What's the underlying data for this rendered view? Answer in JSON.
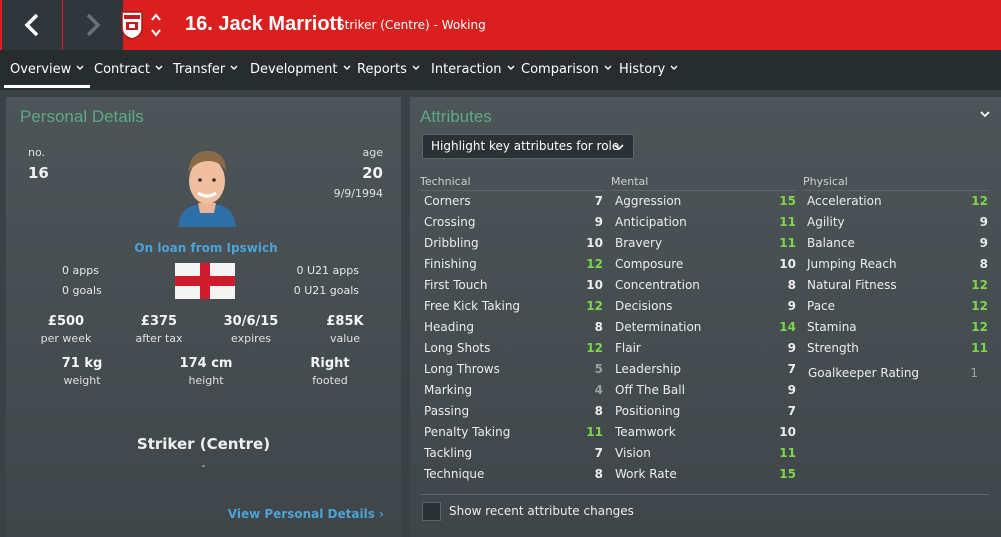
{
  "header": {
    "title": "16. Jack Marriott",
    "subtitle": "Striker (Centre) - Woking"
  },
  "tabs": [
    {
      "label": "Overview",
      "active": true
    },
    {
      "label": "Contract"
    },
    {
      "label": "Transfer"
    },
    {
      "label": "Development"
    },
    {
      "label": "Reports"
    },
    {
      "label": "Interaction"
    },
    {
      "label": "Comparison"
    },
    {
      "label": "History"
    }
  ],
  "personal": {
    "title": "Personal Details",
    "no_label": "no.",
    "no": "16",
    "age_label": "age",
    "age": "20",
    "dob": "9/9/1994",
    "loan": "On loan from Ipswich",
    "apps": "0 apps",
    "goals": "0 goals",
    "u21_apps": "0 U21 apps",
    "u21_goals": "0 U21 goals",
    "wage": "£500",
    "wage_label": "per week",
    "after_tax": "£375",
    "after_tax_label": "after tax",
    "expires": "30/6/15",
    "expires_label": "expires",
    "value": "£85K",
    "value_label": "value",
    "weight": "71 kg",
    "weight_label": "weight",
    "height": "174 cm",
    "height_label": "height",
    "foot": "Right",
    "foot_label": "footed",
    "position": "Striker (Centre)",
    "position_sub": "-",
    "link": "View Personal Details"
  },
  "attributes": {
    "title": "Attributes",
    "dropdown": "Highlight key attributes for role",
    "technical_label": "Technical",
    "mental_label": "Mental",
    "physical_label": "Physical",
    "technical": [
      {
        "name": "Corners",
        "value": "7",
        "hl": false
      },
      {
        "name": "Crossing",
        "value": "9",
        "hl": false
      },
      {
        "name": "Dribbling",
        "value": "10",
        "hl": false
      },
      {
        "name": "Finishing",
        "value": "12",
        "hl": true
      },
      {
        "name": "First Touch",
        "value": "10",
        "hl": false
      },
      {
        "name": "Free Kick Taking",
        "value": "12",
        "hl": true
      },
      {
        "name": "Heading",
        "value": "8",
        "hl": false
      },
      {
        "name": "Long Shots",
        "value": "12",
        "hl": true
      },
      {
        "name": "Long Throws",
        "value": "5",
        "dim": true
      },
      {
        "name": "Marking",
        "value": "4",
        "dim": true
      },
      {
        "name": "Passing",
        "value": "8",
        "hl": false
      },
      {
        "name": "Penalty Taking",
        "value": "11",
        "hl": true
      },
      {
        "name": "Tackling",
        "value": "7",
        "hl": false
      },
      {
        "name": "Technique",
        "value": "8",
        "hl": false
      }
    ],
    "mental": [
      {
        "name": "Aggression",
        "value": "15",
        "hl": true
      },
      {
        "name": "Anticipation",
        "value": "11",
        "hl": true
      },
      {
        "name": "Bravery",
        "value": "11",
        "hl": true
      },
      {
        "name": "Composure",
        "value": "10",
        "hl": false
      },
      {
        "name": "Concentration",
        "value": "8",
        "hl": false
      },
      {
        "name": "Decisions",
        "value": "9",
        "hl": false
      },
      {
        "name": "Determination",
        "value": "14",
        "hl": true
      },
      {
        "name": "Flair",
        "value": "9",
        "hl": false
      },
      {
        "name": "Leadership",
        "value": "7",
        "hl": false
      },
      {
        "name": "Off The Ball",
        "value": "9",
        "hl": false
      },
      {
        "name": "Positioning",
        "value": "7",
        "hl": false
      },
      {
        "name": "Teamwork",
        "value": "10",
        "hl": false
      },
      {
        "name": "Vision",
        "value": "11",
        "hl": true
      },
      {
        "name": "Work Rate",
        "value": "15",
        "hl": true
      }
    ],
    "physical": [
      {
        "name": "Acceleration",
        "value": "12",
        "hl": true
      },
      {
        "name": "Agility",
        "value": "9",
        "hl": false
      },
      {
        "name": "Balance",
        "value": "9",
        "hl": false
      },
      {
        "name": "Jumping Reach",
        "value": "8",
        "hl": false
      },
      {
        "name": "Natural Fitness",
        "value": "12",
        "hl": true
      },
      {
        "name": "Pace",
        "value": "12",
        "hl": true
      },
      {
        "name": "Stamina",
        "value": "12",
        "hl": true
      },
      {
        "name": "Strength",
        "value": "11",
        "hl": true
      }
    ],
    "goalkeeper": {
      "name": "Goalkeeper Rating",
      "value": "1"
    },
    "show_changes": "Show recent attribute changes"
  },
  "colors": {
    "header_red": "#d9201f",
    "accent_green": "#5ca887",
    "highlight_green": "#7ed64a",
    "link_blue": "#4ba3d6"
  }
}
